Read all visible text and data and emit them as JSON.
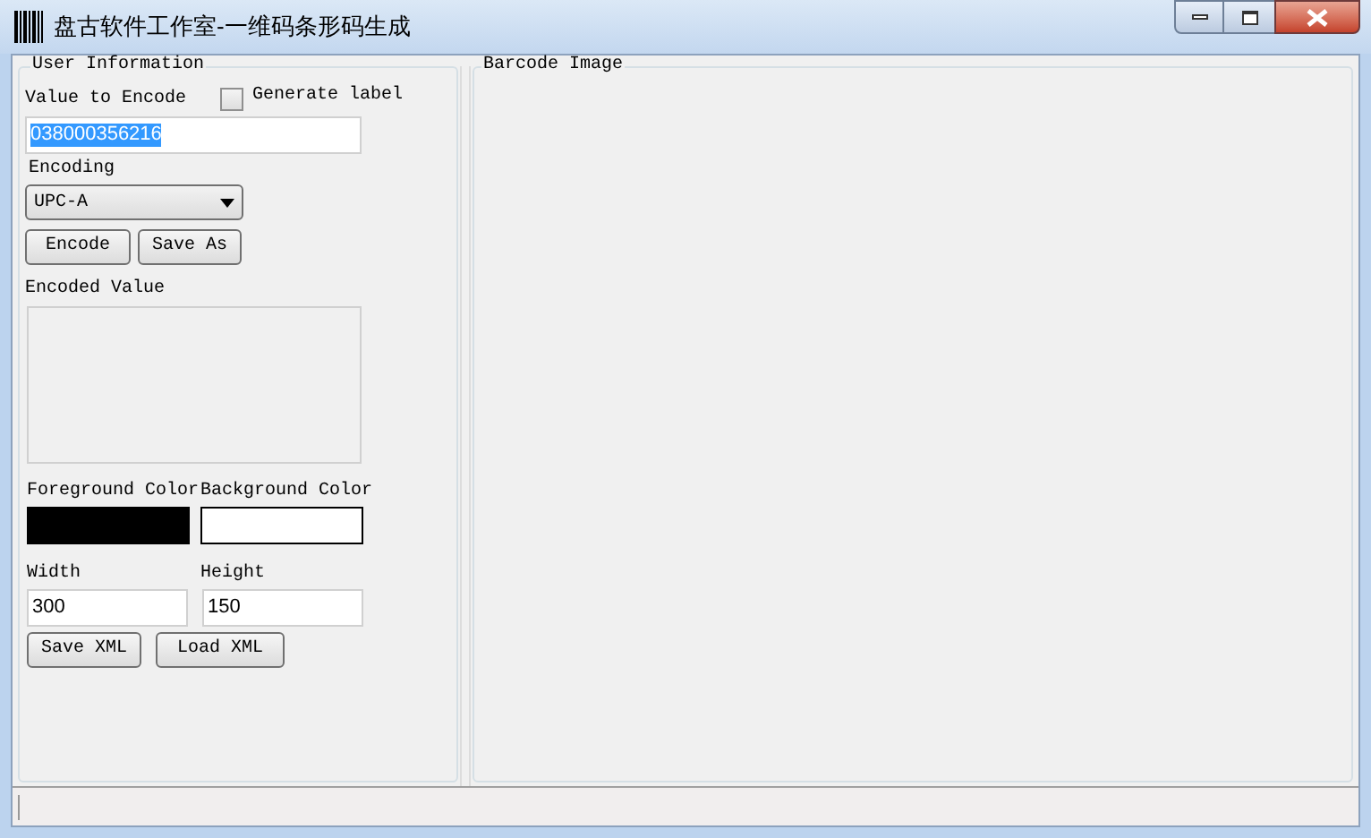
{
  "window": {
    "title": "盘古软件工作室-一维码条形码生成"
  },
  "user_information": {
    "title": "User Information",
    "value_to_encode": {
      "label": "Value to Encode",
      "value": "038000356216",
      "selected": true
    },
    "generate_label": {
      "label": "Generate label",
      "checked": false
    },
    "encoding": {
      "label": "Encoding",
      "value": "UPC-A"
    },
    "actions": [
      "Encode",
      "Save As"
    ],
    "encoded_value": {
      "label": "Encoded Value"
    },
    "colors": [
      {
        "label": "Foreground Color",
        "color": "#000000"
      },
      {
        "label": "Background Color",
        "color": "#ffffff"
      }
    ],
    "sizes": [
      {
        "label": "Width",
        "value": "300"
      },
      {
        "label": "Height",
        "value": "150"
      }
    ],
    "xml_actions": [
      "Save XML",
      "Load XML"
    ]
  },
  "barcode_image": {
    "title": "Barcode Image"
  }
}
